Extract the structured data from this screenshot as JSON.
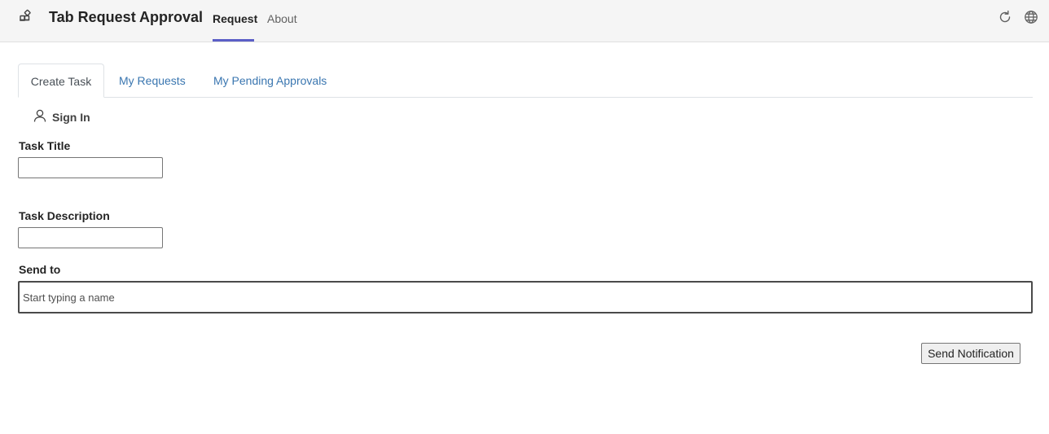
{
  "appbar": {
    "title": "Tab Request Approval",
    "app_icon": "apps-icon",
    "nav": [
      {
        "label": "Request",
        "active": true
      },
      {
        "label": "About",
        "active": false
      }
    ],
    "actions": [
      {
        "icon": "refresh-icon"
      },
      {
        "icon": "globe-icon"
      }
    ],
    "accent_color": "#5b5fc7"
  },
  "tabs": [
    {
      "label": "Create Task",
      "active": true
    },
    {
      "label": "My Requests",
      "active": false
    },
    {
      "label": "My Pending Approvals",
      "active": false
    }
  ],
  "signin": {
    "label": "Sign In",
    "icon": "person-icon"
  },
  "form": {
    "task_title": {
      "label": "Task Title",
      "value": ""
    },
    "task_description": {
      "label": "Task Description",
      "value": ""
    },
    "send_to": {
      "label": "Send to",
      "placeholder": "Start typing a name",
      "value": ""
    },
    "submit_label": "Send Notification"
  },
  "colors": {
    "link": "#3a76b0",
    "appbar_bg": "#f5f5f5"
  }
}
